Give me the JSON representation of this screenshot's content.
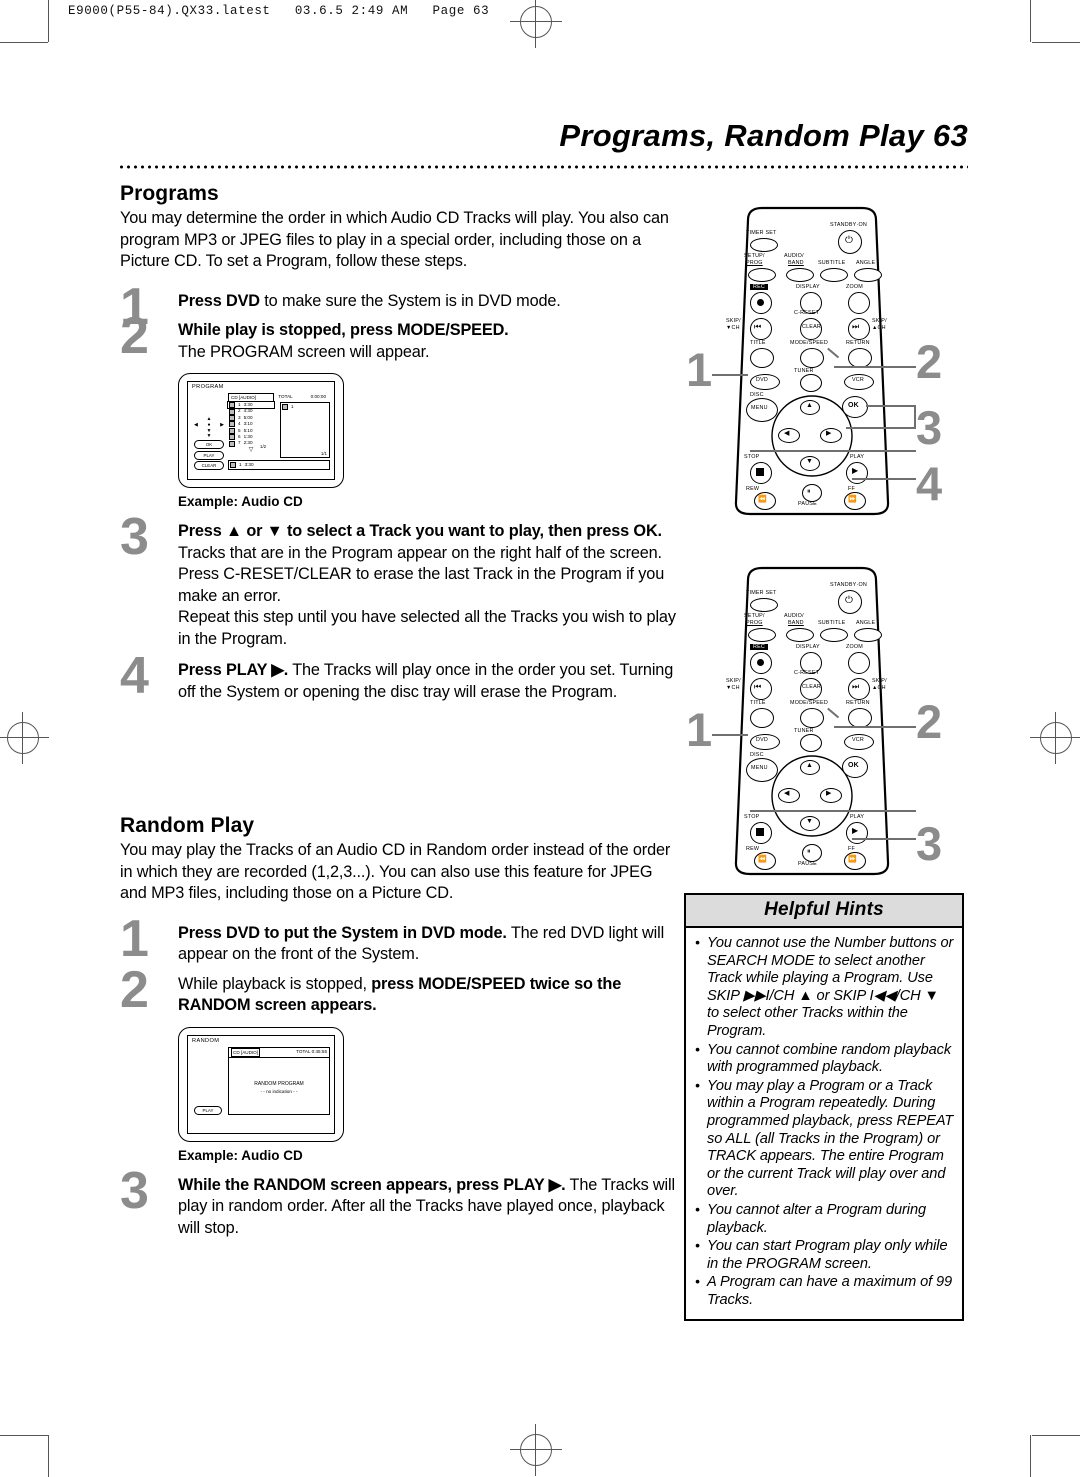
{
  "file_header": "E9000(P55-84).QX33.latest   03.6.5 2:49 AM   Page 63",
  "page_title": "Programs, Random Play  63",
  "programs": {
    "heading": "Programs",
    "intro": "You may determine the order in which Audio CD Tracks will play. You also can program MP3 or JPEG files to play in a special order, including those on a Picture CD. To set a Program, follow these steps.",
    "steps": [
      {
        "num": "1",
        "bold": "Press DVD",
        "rest": " to make sure the System is in DVD mode."
      },
      {
        "num": "2",
        "bold": "While play is stopped, press MODE/SPEED.",
        "rest": "",
        "line2": "The PROGRAM screen will appear."
      },
      {
        "num": "3",
        "bold": "Press ▲ or ▼ to select a Track you want to play, then press OK.",
        "rest": " Tracks that are in the Program appear on the right half of the screen. Press C-RESET/CLEAR to erase the last Track in the Program if you make an error.",
        "line2": "Repeat this step until you have selected all the Tracks you wish to play in the Program."
      },
      {
        "num": "4",
        "bold": "Press PLAY ▶.",
        "rest": " The Tracks will play once in the order you set. Turning off the System or opening the disc tray will erase the Program."
      }
    ],
    "osd": {
      "title": "PROGRAM",
      "disc_label": "CD [AUDIO]",
      "total_label": "TOTAL",
      "total_value": "0:00:00",
      "tracks": [
        {
          "n": "1",
          "time": "3:30"
        },
        {
          "n": "2",
          "time": "4:30"
        },
        {
          "n": "3",
          "time": "5:00"
        },
        {
          "n": "4",
          "time": "3:10"
        },
        {
          "n": "5",
          "time": "5:10"
        },
        {
          "n": "6",
          "time": "1:30"
        },
        {
          "n": "7",
          "time": "2:30"
        }
      ],
      "left_page": "1/2",
      "right_page": "1/1",
      "program_entry": "1",
      "bottom_n": "1",
      "bottom_time": "3:30",
      "keys": {
        "ok": "OK",
        "play": "PLAY",
        "clear": "CLEAR"
      },
      "caption": "Example:  Audio CD"
    }
  },
  "random": {
    "heading": "Random Play",
    "intro": "You may play the Tracks of an Audio CD in Random order instead of the order in which they are recorded (1,2,3...). You can also use this feature for JPEG and MP3 files, including those on a Picture CD.",
    "steps": [
      {
        "num": "1",
        "bold": "Press DVD to put the System in DVD mode.",
        "rest": " The red DVD light will appear on the front of the System."
      },
      {
        "num": "2",
        "pre": "While playback is stopped, ",
        "bold": "press MODE/SPEED twice so the RANDOM screen appears.",
        "rest": ""
      },
      {
        "num": "3",
        "bold": "While the RANDOM screen appears, press PLAY ▶.",
        "rest": " The Tracks will play in random order. After all the Tracks have played once, playback will stop."
      }
    ],
    "osd": {
      "title": "RANDOM",
      "disc_label": "CD [AUDIO]",
      "total_label": "TOTAL",
      "total_value": "0:45:55",
      "msg1": "RANDOM PROGRAM",
      "msg2": "- -  no  indication  - -",
      "play_key": "PLAY",
      "caption": "Example: Audio CD"
    }
  },
  "remote": {
    "labels": {
      "timer_set": "TIMER SET",
      "standby_on": "STANDBY·ON",
      "setup": "SETUP/",
      "prog": "PROG",
      "audio": "AUDIO/",
      "band": "BAND",
      "subtitle": "SUBTITLE",
      "angle": "ANGLE",
      "rec": "REC",
      "display": "DISPLAY",
      "zoom": "ZOOM",
      "skip_down": "SKIP/",
      "ch_down": "▼CH",
      "creset": "C-RESET",
      "clear": "CLEAR",
      "skip_up": "SKIP/",
      "ch_up": "▲CH",
      "title": "TITLE",
      "mode_speed": "MODE/SPEED",
      "return": "RETURN",
      "dvd": "DVD",
      "tuner": "TUNER",
      "vcr": "VCR",
      "disc": "DISC",
      "menu": "MENU",
      "ok": "OK",
      "stop": "STOP",
      "play": "PLAY",
      "rew": "REW",
      "pause": "PAUSE",
      "ff": "FF"
    },
    "callouts_top": [
      "1",
      "2",
      "3",
      "4"
    ],
    "callouts_bottom": [
      "1",
      "2",
      "3"
    ]
  },
  "hints": {
    "title": "Helpful Hints",
    "items": [
      "You cannot use the Number buttons or SEARCH MODE to select another Track while playing a Program.  Use SKIP ▶▶I/CH ▲ or SKIP I◀◀/CH ▼ to select other Tracks within the Program.",
      "You cannot combine random playback with programmed playback.",
      "You may play a Program or a Track within a Program repeatedly. During programmed playback, press REPEAT so ALL (all Tracks in the Program) or TRACK appears. The entire Program or the current Track will play over and over.",
      "You cannot alter a Program during playback.",
      "You can start Program play only while in the PROGRAM screen.",
      "A Program can have a maximum of 99 Tracks."
    ]
  }
}
